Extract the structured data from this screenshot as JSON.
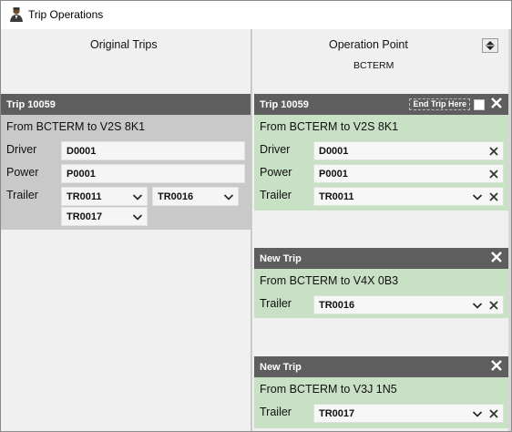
{
  "window": {
    "title": "Trip Operations"
  },
  "left": {
    "heading": "Original Trips",
    "trip": {
      "header": "Trip 10059",
      "route": "From BCTERM to V2S 8K1",
      "driver_label": "Driver",
      "driver_value": "D0001",
      "power_label": "Power",
      "power_value": "P0001",
      "trailer_label": "Trailer",
      "trailers": [
        "TR0011",
        "TR0016",
        "TR0017"
      ]
    }
  },
  "right": {
    "heading": "Operation Point",
    "sub": "BCTERM",
    "trip": {
      "header": "Trip 10059",
      "end_trip_label": "End Trip Here",
      "route": "From BCTERM to V2S 8K1",
      "driver_label": "Driver",
      "driver_value": "D0001",
      "power_label": "Power",
      "power_value": "P0001",
      "trailer_label": "Trailer",
      "trailer_value": "TR0011"
    },
    "new_trips": [
      {
        "header": "New Trip",
        "route": "From BCTERM to V4X 0B3",
        "trailer_label": "Trailer",
        "trailer_value": "TR0016"
      },
      {
        "header": "New Trip",
        "route": "From BCTERM to V3J 1N5",
        "trailer_label": "Trailer",
        "trailer_value": "TR0017"
      }
    ]
  },
  "colors": {
    "card_header": "#5e5e5e",
    "original_body": "#c9c9c9",
    "operation_body": "#c8e0c4"
  },
  "icons": [
    "user-icon",
    "sort-icon",
    "close-icon",
    "chevron-down-icon",
    "remove-icon"
  ]
}
